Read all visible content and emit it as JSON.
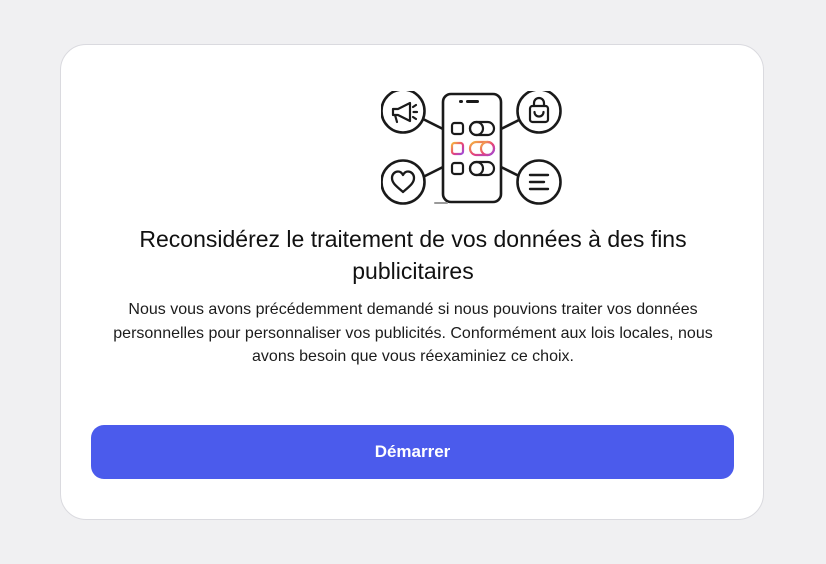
{
  "dialog": {
    "title": "Reconsidérez le traitement de vos données à des fins publicitaires",
    "description": "Nous vous avons précédemment demandé si nous pouvions traiter vos données personnelles pour personnaliser vos publicités. Conformément aux lois locales, nous avons besoin que vous réexaminiez ce choix.",
    "primary_button_label": "Démarrer"
  },
  "illustration": {
    "icons": [
      "megaphone-icon",
      "shopping-bag-icon",
      "heart-icon",
      "list-icon",
      "phone-icon"
    ]
  },
  "colors": {
    "page_background": "#f0f0f2",
    "card_background": "#ffffff",
    "primary_button": "#4b5bec",
    "text": "#111111",
    "highlight_gradient": [
      "#f6b73c",
      "#e4407d",
      "#9b4bdc"
    ]
  }
}
